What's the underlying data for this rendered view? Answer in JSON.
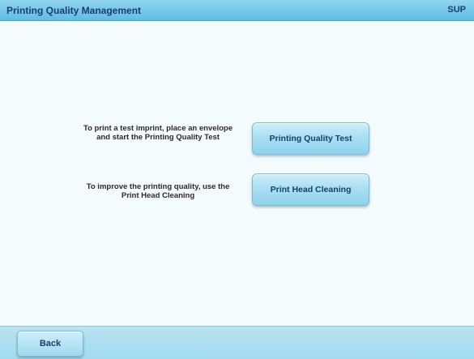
{
  "header": {
    "title": "Printing Quality Management",
    "mode": "SUP"
  },
  "main": {
    "rows": [
      {
        "description": "To print a test imprint, place an envelope and start the Printing Quality Test",
        "button_label": "Printing Quality Test"
      },
      {
        "description": "To improve the printing quality, use the Print Head Cleaning",
        "button_label": "Print Head Cleaning"
      }
    ]
  },
  "footer": {
    "back_label": "Back"
  },
  "colors": {
    "title_bar": "#74c7e6",
    "background": "#f3fbfd",
    "button": "#a9dff2",
    "text_dark": "#1a3d6e"
  }
}
